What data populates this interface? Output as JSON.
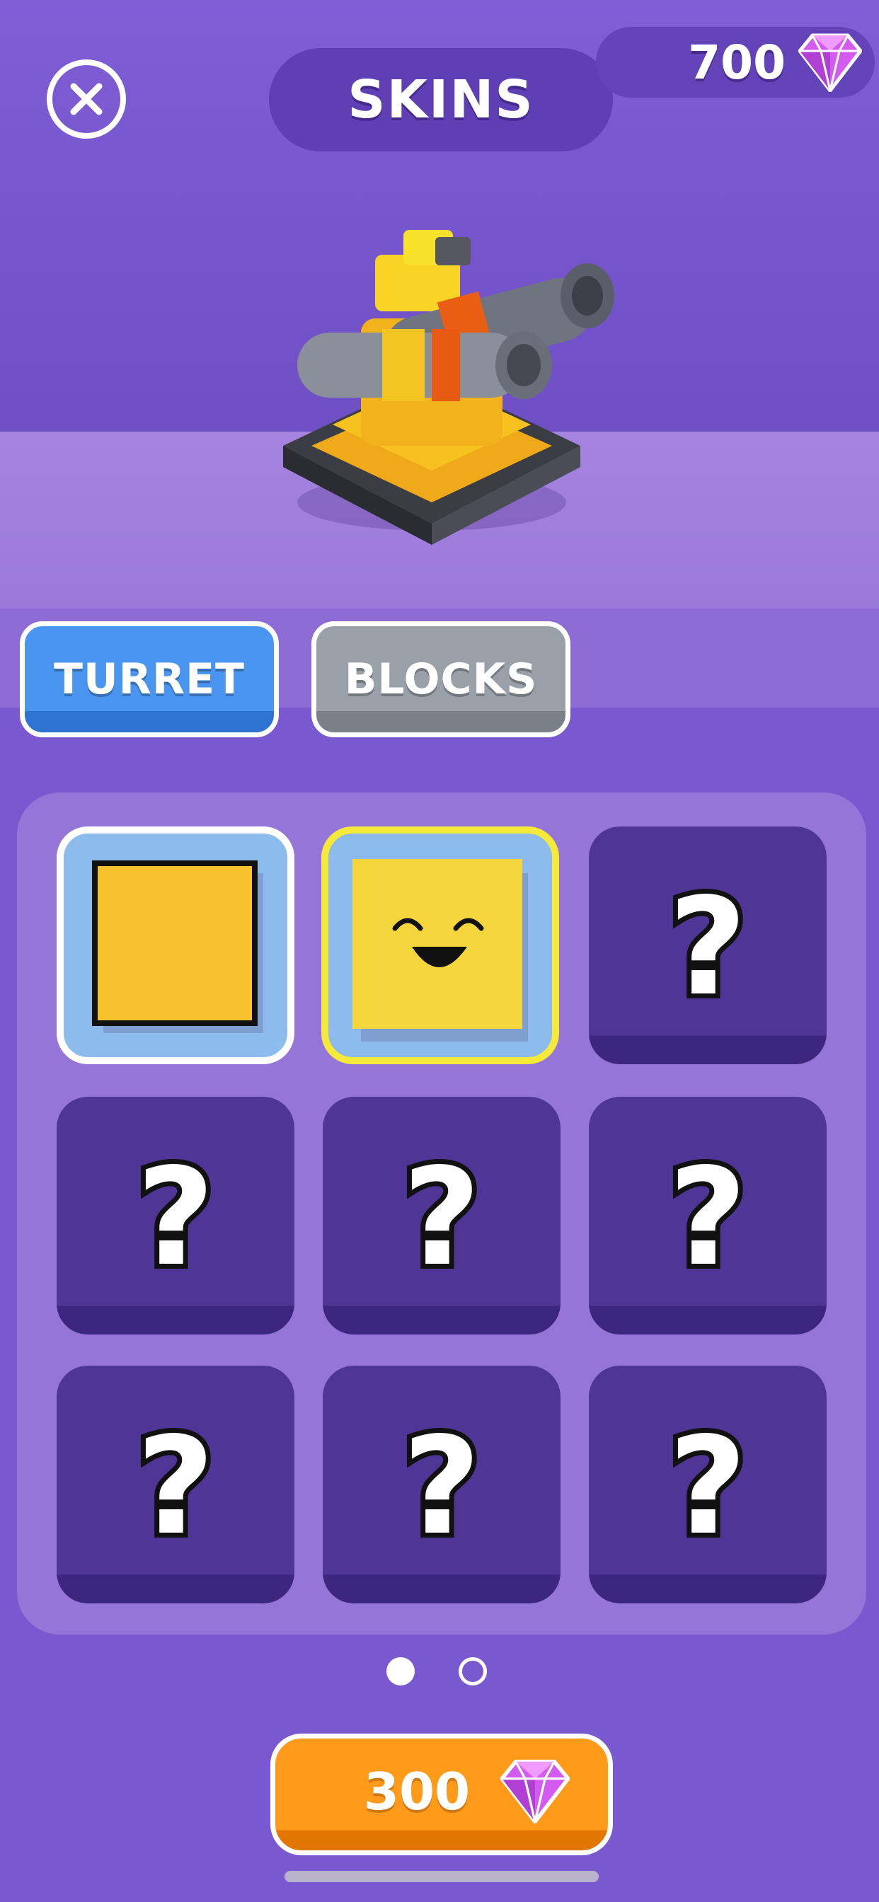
{
  "header": {
    "title": "SKINS",
    "close_icon": "close-icon",
    "currency": {
      "value": "700",
      "icon": "gem-icon",
      "color": "#d35bf0"
    }
  },
  "preview": {
    "icon": "turret-preview"
  },
  "tabs": [
    {
      "label": "TURRET",
      "active": true,
      "color": "#4a95f0"
    },
    {
      "label": "BLOCKS",
      "active": false,
      "color": "#9aa0a8"
    }
  ],
  "skins": [
    {
      "state": "selected",
      "icon": "plain-yellow-block-icon"
    },
    {
      "state": "equipped",
      "icon": "smiley-block-icon"
    },
    {
      "state": "locked",
      "icon": "question-mark-icon"
    },
    {
      "state": "locked",
      "icon": "question-mark-icon"
    },
    {
      "state": "locked",
      "icon": "question-mark-icon"
    },
    {
      "state": "locked",
      "icon": "question-mark-icon"
    },
    {
      "state": "locked",
      "icon": "question-mark-icon"
    },
    {
      "state": "locked",
      "icon": "question-mark-icon"
    },
    {
      "state": "locked",
      "icon": "question-mark-icon"
    }
  ],
  "pagination": {
    "current": 1,
    "total": 2
  },
  "buy": {
    "price": "300",
    "icon": "gem-icon",
    "color": "#ff9a1a"
  }
}
